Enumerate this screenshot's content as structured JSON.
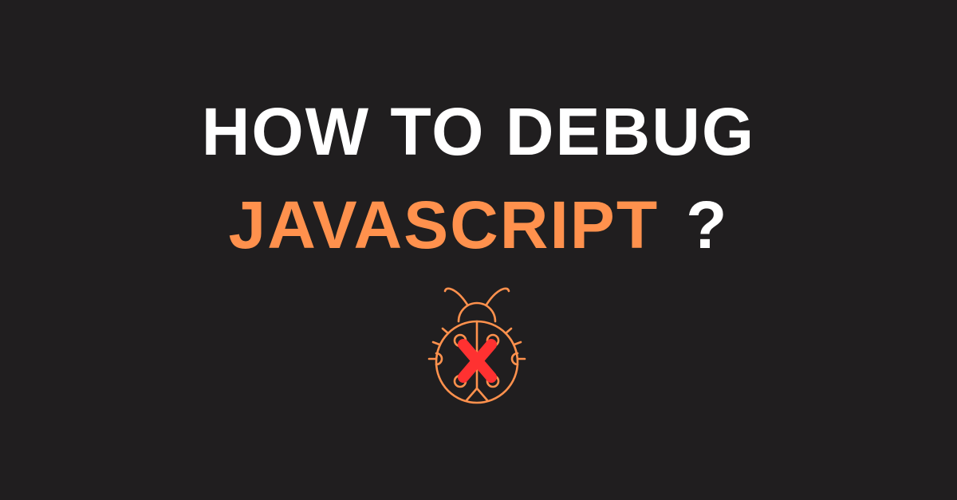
{
  "title": {
    "line1": "HOW TO DEBUG",
    "line2": "JAVASCRIPT",
    "question_mark": "?"
  },
  "icon": {
    "name": "bug-with-x-icon"
  },
  "colors": {
    "background": "#201e1f",
    "accent": "#ff914d",
    "error": "#ff3131",
    "text": "#ffffff"
  }
}
